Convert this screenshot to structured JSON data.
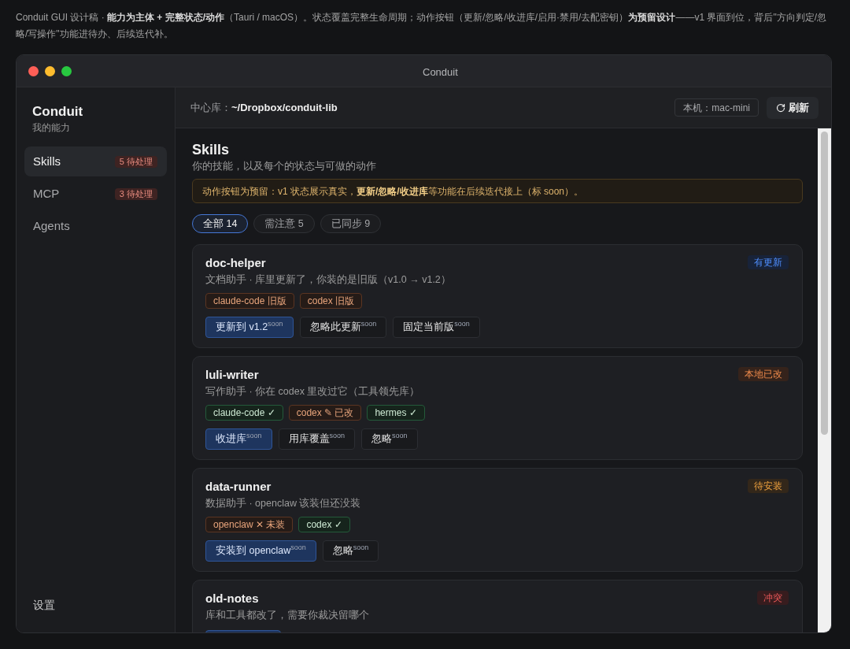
{
  "caption": "Conduit GUI 设计稿 · **能力为主体 + 完整状态/动作**（Tauri / macOS）。状态覆盖完整生命周期；动作按钮（更新/忽略/收进库/启用·禁用/去配密钥）**为预留设计**——v1 界面到位，背后\"方向判定/忽略/写操作\"功能进待办、后续迭代补。",
  "window": {
    "title": "Conduit"
  },
  "sidebar": {
    "app_name": "Conduit",
    "subtitle": "我的能力",
    "items": [
      {
        "label": "Skills",
        "badge": "5 待处理",
        "selected": true
      },
      {
        "label": "MCP",
        "badge": "3 待处理",
        "selected": false
      },
      {
        "label": "Agents",
        "selected": false
      }
    ],
    "footer": "设置"
  },
  "header": {
    "library_label": "中心库：",
    "library_path": "~/Dropbox/conduit-lib",
    "machine": "本机：mac-mini",
    "refresh_button": "刷新"
  },
  "content": {
    "title": "Skills",
    "subtitle": "你的技能，以及每个的状态与可做的动作",
    "notice": "动作按钮为预留：v1 状态展示真实，**更新/忽略/收进库**等功能在后续迭代接上（标 soon）。",
    "filters": [
      {
        "label": "全部 14",
        "selected": true
      },
      {
        "label": "需注意 5",
        "selected": false
      },
      {
        "label": "已同步 9",
        "selected": false
      }
    ],
    "skills": [
      {
        "name": "doc-helper",
        "description": "文档助手 · 库里更新了，你装的是旧版（v1.0 → v1.2）",
        "status": {
          "label": "有更新",
          "kind": "update"
        },
        "tags": [
          {
            "label": "claude-code 旧版",
            "kind": "warn"
          },
          {
            "label": "codex 旧版",
            "kind": "warn"
          }
        ],
        "actions": [
          {
            "label": "更新到 v1.2$^{soon}$",
            "kind": "primary"
          },
          {
            "label": "忽略此更新$^{soon}$",
            "kind": "secondary"
          },
          {
            "label": "固定当前版$^{soon}$",
            "kind": "secondary"
          }
        ]
      },
      {
        "name": "luli-writer",
        "description": "写作助手 · 你在 codex 里改过它（工具领先库）",
        "status": {
          "label": "本地已改",
          "kind": "modified"
        },
        "tags": [
          {
            "label": "claude-code ✓",
            "kind": "ok"
          },
          {
            "label": "codex ✎ 已改",
            "kind": "warn"
          },
          {
            "label": "hermes ✓",
            "kind": "ok"
          }
        ],
        "actions": [
          {
            "label": "收进库$^{soon}$",
            "kind": "primary"
          },
          {
            "label": "用库覆盖$^{soon}$",
            "kind": "secondary"
          },
          {
            "label": "忽略$^{soon}$",
            "kind": "secondary"
          }
        ]
      },
      {
        "name": "data-runner",
        "description": "数据助手 · openclaw 该装但还没装",
        "status": {
          "label": "待安装",
          "kind": "pending"
        },
        "tags": [
          {
            "label": "openclaw ✕ 未装",
            "kind": "warn"
          },
          {
            "label": "codex ✓",
            "kind": "ok"
          }
        ],
        "actions": [
          {
            "label": "安装到 openclaw$^{soon}$",
            "kind": "primary"
          },
          {
            "label": "忽略$^{soon}$",
            "kind": "secondary"
          }
        ]
      },
      {
        "name": "old-notes",
        "description": "库和工具都改了，需要你裁决留哪个",
        "status": {
          "label": "冲突",
          "kind": "conflict"
        },
        "actions": [
          {
            "kind": "primary"
          }
        ]
      }
    ]
  }
}
